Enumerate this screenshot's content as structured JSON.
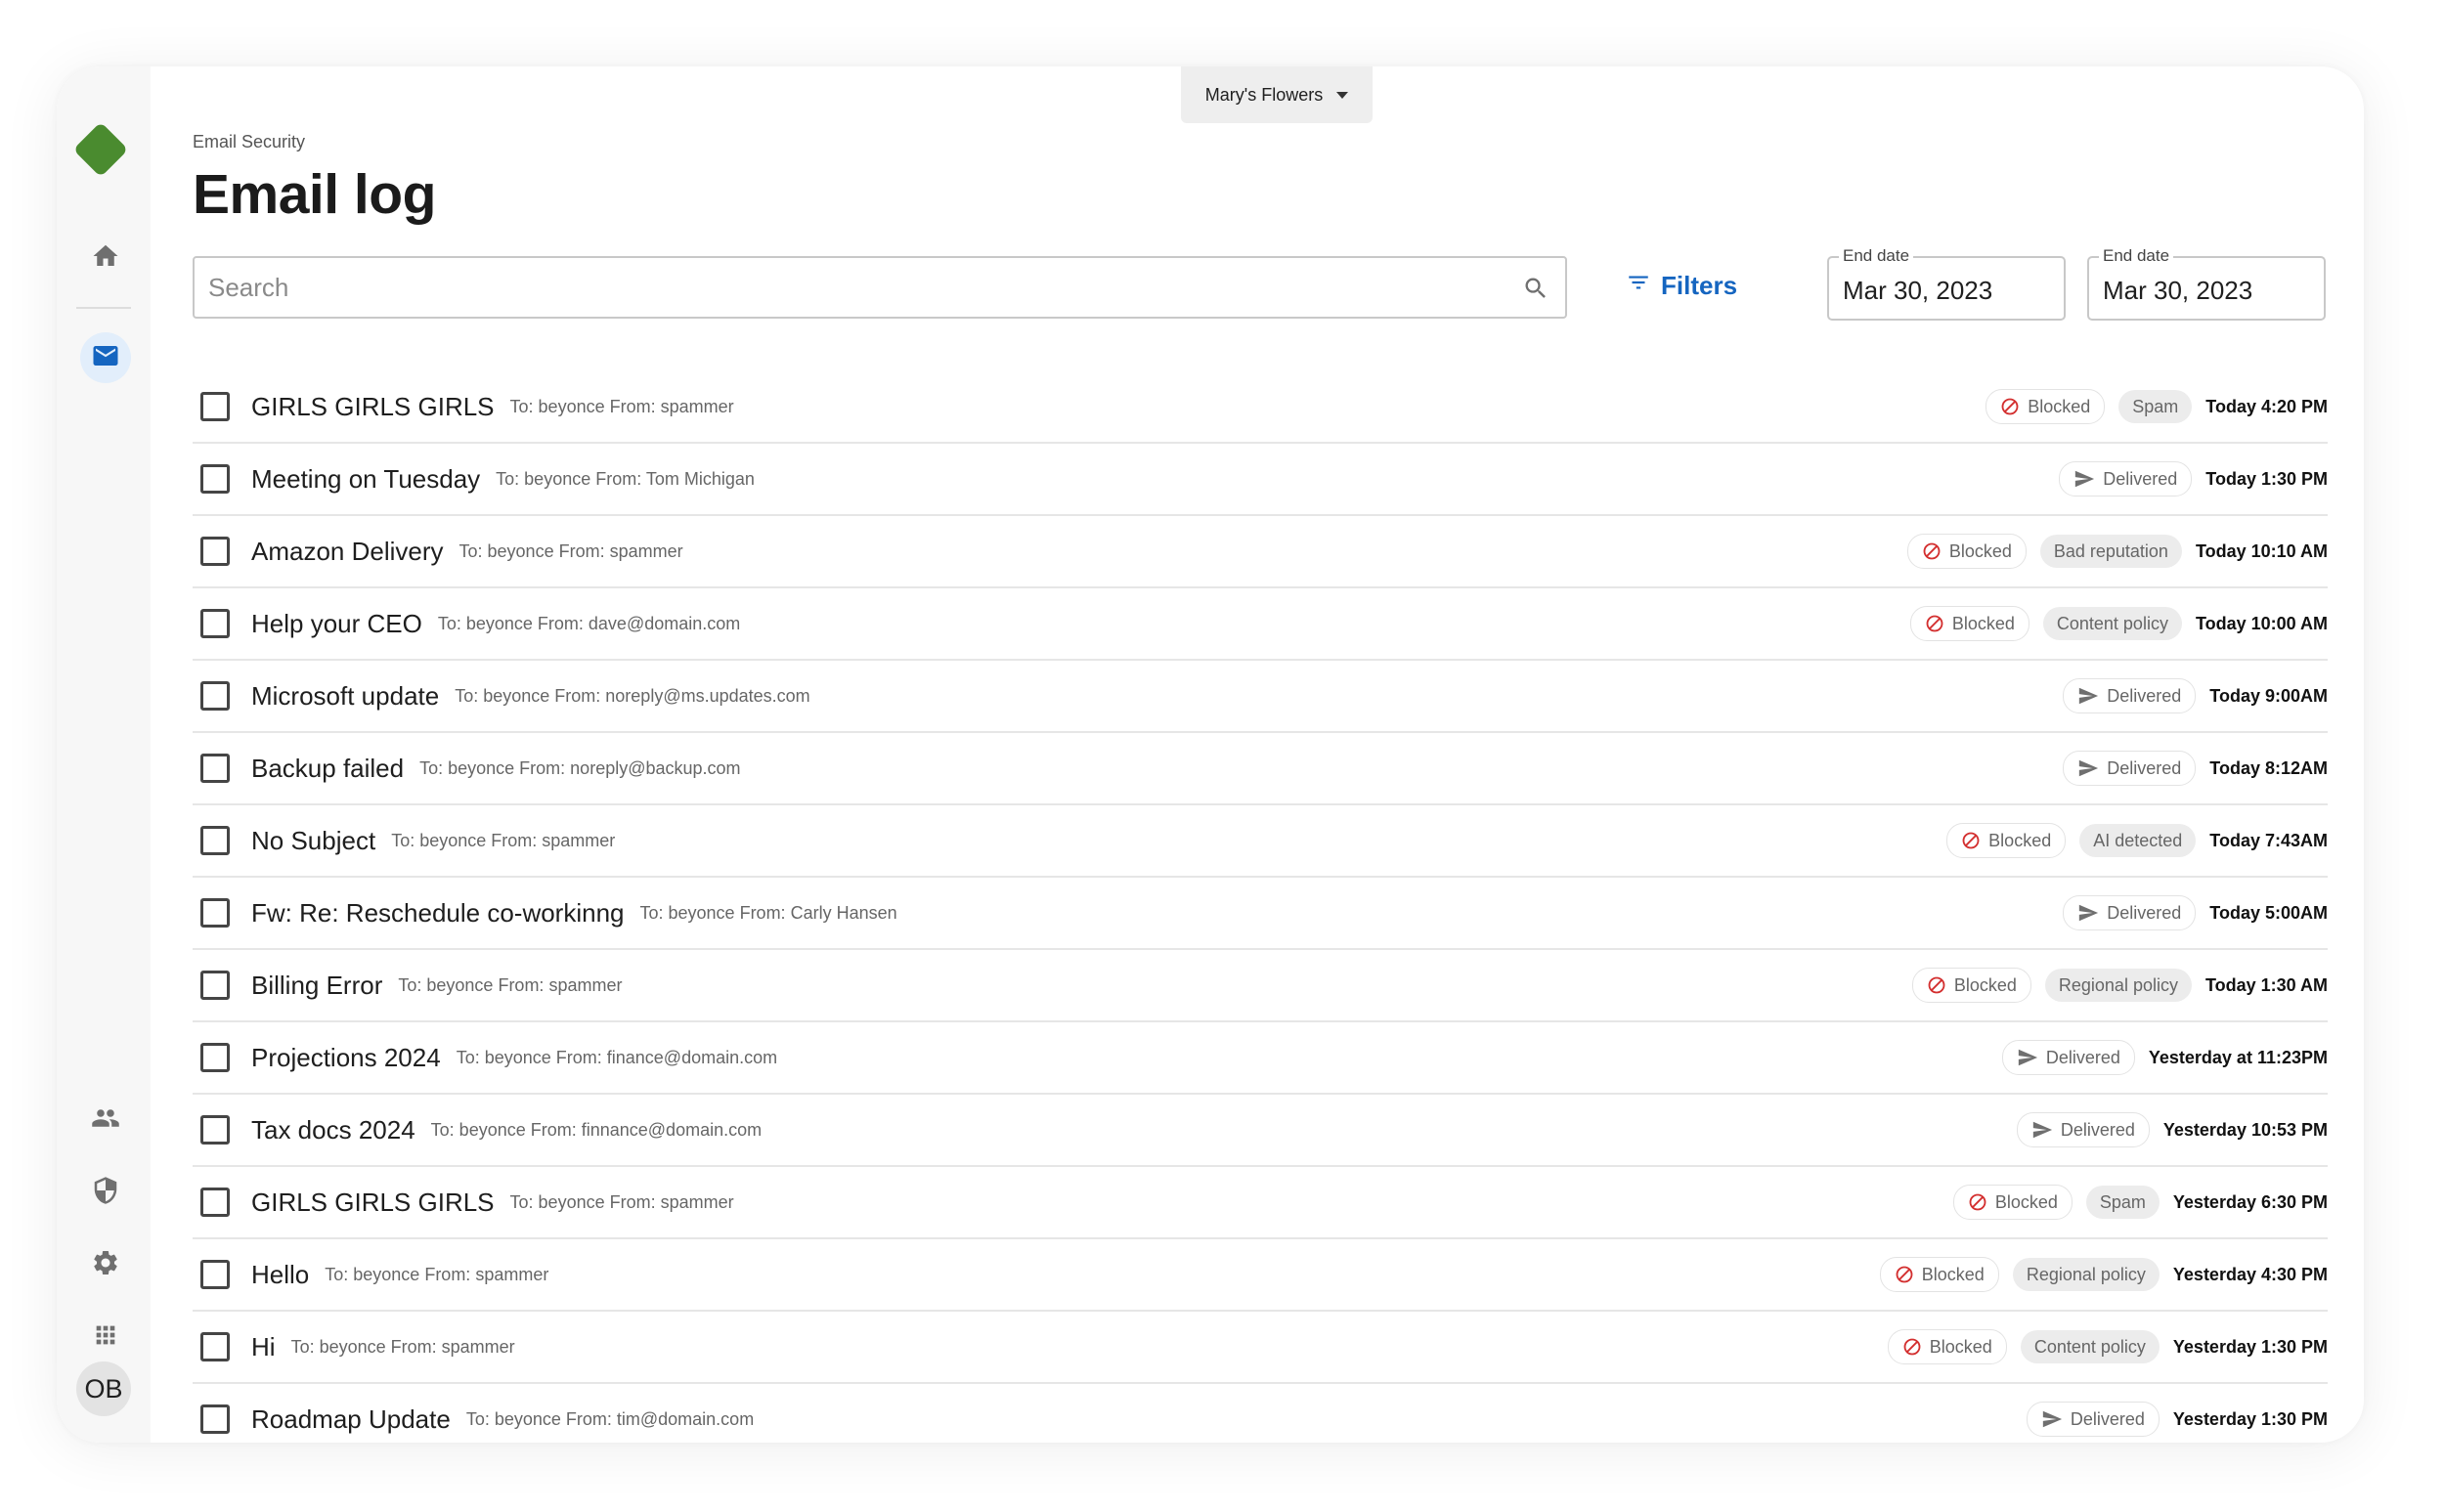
{
  "org": {
    "name": "Mary's Flowers"
  },
  "breadcrumb": "Email Security",
  "title": "Email log",
  "search": {
    "placeholder": "Search"
  },
  "filters": {
    "label": "Filters"
  },
  "dates": [
    {
      "label": "End date",
      "value": "Mar 30, 2023"
    },
    {
      "label": "End date",
      "value": "Mar 30, 2023"
    }
  ],
  "user": {
    "initials": "OB"
  },
  "nav": [
    "home-icon",
    "mail-icon",
    "people-icon",
    "shield-icon",
    "gear-icon",
    "apps-icon"
  ],
  "colors": {
    "brand": "#4a8b2f",
    "accent": "#1565c0",
    "blocked": "#d32f2f"
  },
  "emails": [
    {
      "subject": "GIRLS GIRLS GIRLS",
      "meta": "To: beyonce From: spammer",
      "status": "Blocked",
      "reason": "Spam",
      "time": "Today 4:20 PM"
    },
    {
      "subject": "Meeting on Tuesday",
      "meta": "To: beyonce From:  Tom Michigan",
      "status": "Delivered",
      "reason": "",
      "time": "Today 1:30 PM"
    },
    {
      "subject": "Amazon Delivery",
      "meta": "To: beyonce From: spammer",
      "status": "Blocked",
      "reason": "Bad reputation",
      "time": "Today 10:10 AM"
    },
    {
      "subject": "Help your CEO",
      "meta": "To: beyonce From: dave@domain.com",
      "status": "Blocked",
      "reason": "Content policy",
      "time": "Today 10:00 AM"
    },
    {
      "subject": "Microsoft update",
      "meta": "To: beyonce From: noreply@ms.updates.com",
      "status": "Delivered",
      "reason": "",
      "time": "Today 9:00AM"
    },
    {
      "subject": "Backup failed",
      "meta": "To: beyonce From: noreply@backup.com",
      "status": "Delivered",
      "reason": "",
      "time": "Today 8:12AM"
    },
    {
      "subject": "No Subject",
      "meta": "To: beyonce From: spammer",
      "status": "Blocked",
      "reason": "AI detected",
      "time": "Today 7:43AM"
    },
    {
      "subject": "Fw: Re: Reschedule co-workinng",
      "meta": "To: beyonce From: Carly Hansen",
      "status": "Delivered",
      "reason": "",
      "time": "Today 5:00AM"
    },
    {
      "subject": "Billing Error",
      "meta": "To: beyonce From: spammer",
      "status": "Blocked",
      "reason": "Regional policy",
      "time": "Today 1:30 AM"
    },
    {
      "subject": "Projections 2024",
      "meta": "To: beyonce From: finance@domain.com",
      "status": "Delivered",
      "reason": "",
      "time": "Yesterday at 11:23PM"
    },
    {
      "subject": "Tax docs 2024",
      "meta": "To: beyonce From: finnance@domain.com",
      "status": "Delivered",
      "reason": "",
      "time": "Yesterday 10:53 PM"
    },
    {
      "subject": "GIRLS GIRLS GIRLS",
      "meta": "To: beyonce From: spammer",
      "status": "Blocked",
      "reason": "Spam",
      "time": "Yesterday 6:30 PM"
    },
    {
      "subject": "Hello",
      "meta": "To: beyonce From: spammer",
      "status": "Blocked",
      "reason": "Regional policy",
      "time": "Yesterday 4:30 PM"
    },
    {
      "subject": "Hi",
      "meta": "To: beyonce From: spammer",
      "status": "Blocked",
      "reason": "Content policy",
      "time": "Yesterday 1:30 PM"
    },
    {
      "subject": "Roadmap Update",
      "meta": "To: beyonce From: tim@domain.com",
      "status": "Delivered",
      "reason": "",
      "time": "Yesterday 1:30 PM"
    }
  ]
}
